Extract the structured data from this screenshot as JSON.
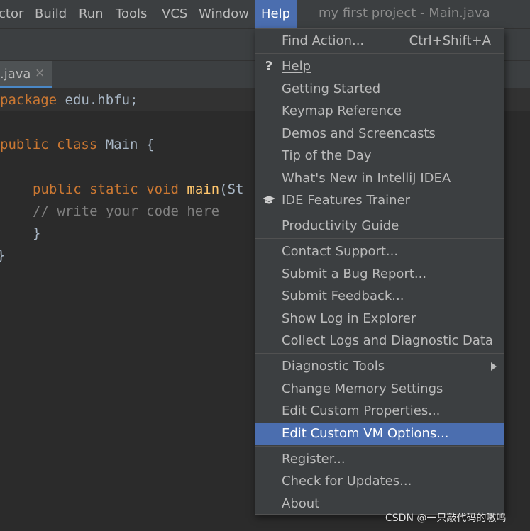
{
  "menubar": {
    "items": [
      "ctor",
      "Build",
      "Run",
      "Tools",
      "VCS",
      "Window",
      "Help"
    ],
    "window_title": "my first project - Main.java"
  },
  "tab": {
    "label": ".java",
    "close": "×"
  },
  "code": {
    "line1": [
      "package",
      " edu.hbfu;"
    ],
    "line2": [
      "public",
      " ",
      "class",
      " Main {"
    ],
    "line3": [
      "public",
      " ",
      "static",
      " ",
      "void",
      " ",
      "main",
      "(St"
    ],
    "line4": "// write your code here",
    "line5": "}",
    "line6": "}"
  },
  "help_menu": {
    "find_action": {
      "label": "Find Action...",
      "shortcut": "Ctrl+Shift+A"
    },
    "group1": [
      {
        "icon": "question-icon",
        "glyph": "?",
        "label": "Help"
      },
      {
        "label": "Getting Started"
      },
      {
        "label": "Keymap Reference"
      },
      {
        "label": "Demos and Screencasts"
      },
      {
        "label": "Tip of the Day"
      },
      {
        "label": "What's New in IntelliJ IDEA"
      },
      {
        "icon": "graduation-cap-icon",
        "label": "IDE Features Trainer"
      }
    ],
    "group2": [
      {
        "label": "Productivity Guide"
      }
    ],
    "group3": [
      {
        "label": "Contact Support..."
      },
      {
        "label": "Submit a Bug Report..."
      },
      {
        "label": "Submit Feedback..."
      },
      {
        "label": "Show Log in Explorer"
      },
      {
        "label": "Collect Logs and Diagnostic Data"
      }
    ],
    "group4": [
      {
        "label": "Diagnostic Tools",
        "submenu": true
      },
      {
        "label": "Change Memory Settings"
      },
      {
        "label": "Edit Custom Properties..."
      },
      {
        "label": "Edit Custom VM Options...",
        "selected": true
      }
    ],
    "group5": [
      {
        "label": "Register..."
      },
      {
        "label": "Check for Updates..."
      },
      {
        "label": "About"
      }
    ]
  },
  "watermark": "CSDN @一只敲代码的嗷呜",
  "colors": {
    "selection": "#4b6eaf",
    "keyword": "#cc7832",
    "function": "#ffc66d",
    "comment": "#808080"
  }
}
